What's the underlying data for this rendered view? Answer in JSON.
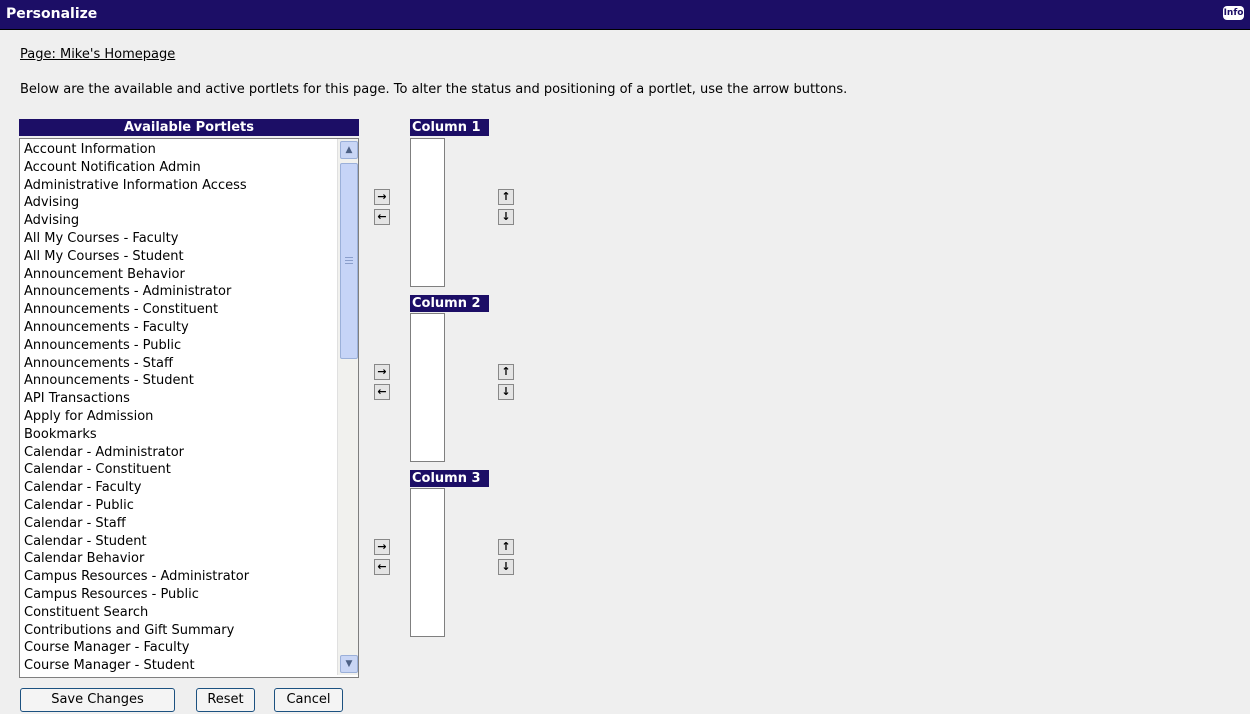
{
  "titlebar": {
    "title": "Personalize",
    "info_label": "Info"
  },
  "page_link": "Page: Mike's Homepage",
  "description": "Below are the available and active portlets for this page. To alter the status and positioning of a portlet, use the arrow buttons.",
  "available": {
    "header": "Available Portlets",
    "items": [
      "Account Information",
      "Account Notification Admin",
      "Administrative Information Access",
      "Advising",
      "Advising",
      "All My Courses - Faculty",
      "All My Courses - Student",
      "Announcement Behavior",
      "Announcements - Administrator",
      "Announcements - Constituent",
      "Announcements - Faculty",
      "Announcements - Public",
      "Announcements - Staff",
      "Announcements - Student",
      "API Transactions",
      "Apply for Admission",
      "Bookmarks",
      "Calendar - Administrator",
      "Calendar - Constituent",
      "Calendar - Faculty",
      "Calendar - Public",
      "Calendar - Staff",
      "Calendar - Student",
      "Calendar Behavior",
      "Campus Resources - Administrator",
      "Campus Resources - Public",
      "Constituent Search",
      "Contributions and Gift Summary",
      "Course Manager - Faculty",
      "Course Manager - Student"
    ]
  },
  "columns": [
    {
      "header": "Column 1"
    },
    {
      "header": "Column 2"
    },
    {
      "header": "Column 3"
    }
  ],
  "icons": {
    "move_right": "→",
    "move_left": "←",
    "move_up": "↑",
    "move_down": "↓",
    "scroll_up": "▲",
    "scroll_down": "▼"
  },
  "buttons": {
    "save": "Save Changes",
    "reset": "Reset",
    "cancel": "Cancel"
  },
  "colors": {
    "accent": "#1c0e66",
    "background": "#efefef"
  }
}
